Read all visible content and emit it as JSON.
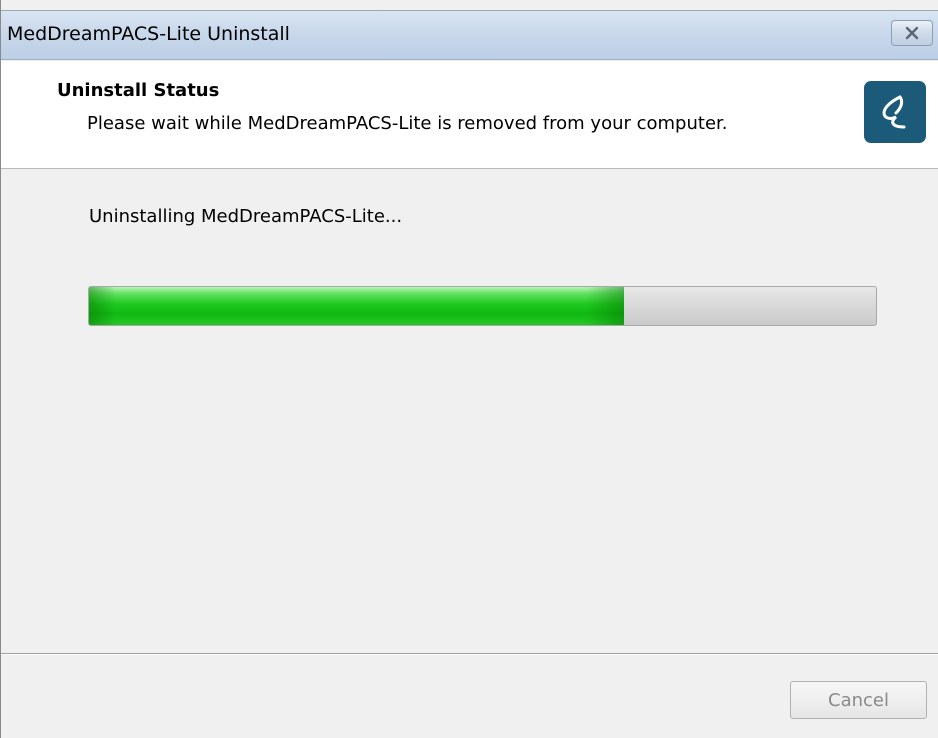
{
  "window": {
    "title": "MedDreamPACS-Lite Uninstall",
    "close_glyph": "×"
  },
  "header": {
    "title": "Uninstall Status",
    "subtitle": "Please wait while MedDreamPACS-Lite is removed from your computer.",
    "logo_icon": "meddream-logo-icon"
  },
  "body": {
    "status": "Uninstalling MedDreamPACS-Lite...",
    "progress_percent": 68
  },
  "footer": {
    "cancel_label": "Cancel",
    "cancel_enabled": false
  },
  "colors": {
    "titlebar": "#c9d8eb",
    "progress_fill": "#1fc91f",
    "logo_bg": "#1c5a7a"
  }
}
